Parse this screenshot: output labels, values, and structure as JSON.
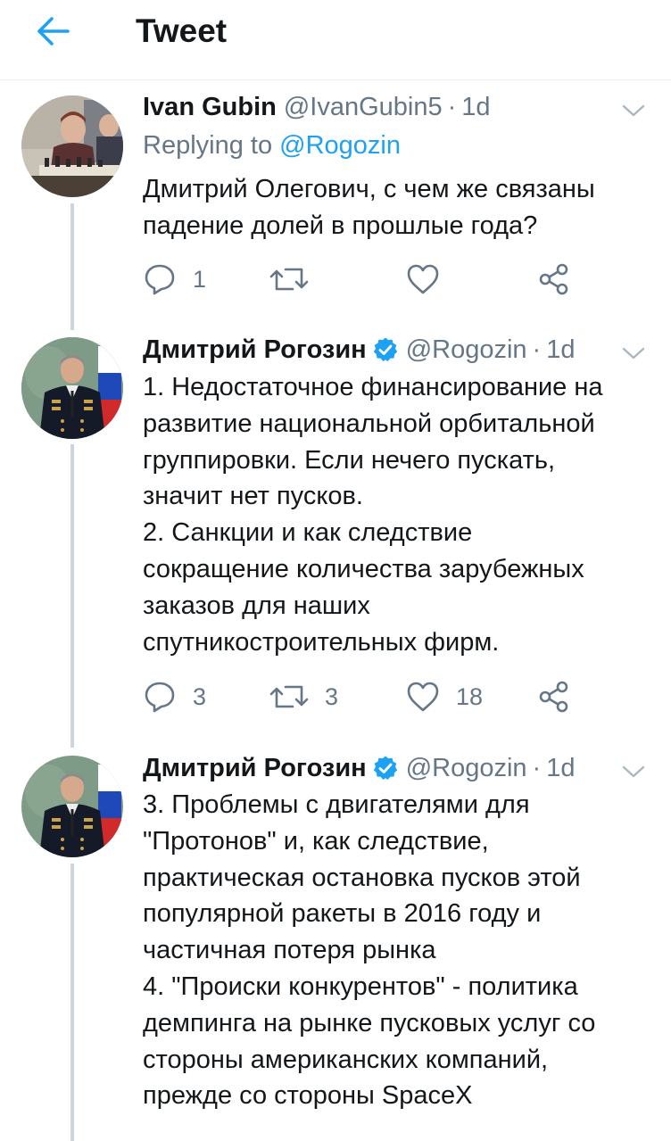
{
  "header": {
    "title": "Tweet",
    "back_icon": "arrow-left-icon",
    "accent": "#1da1f2"
  },
  "tweets": [
    {
      "name": "Ivan Gubin",
      "handle": "@IvanGubin5",
      "separator": "·",
      "time": "1d",
      "verified": false,
      "replying_prefix": "Replying to",
      "replying_mention": "@Rogozin",
      "text": "Дмитрий Олегович, с чем же связаны\nпадение долей в прошлые года?",
      "replies": "1",
      "retweets": "",
      "likes": ""
    },
    {
      "name": "Дмитрий Рогозин",
      "handle": "@Rogozin",
      "separator": "·",
      "time": "1d",
      "verified": true,
      "text": "1. Недостаточное финансирование на\nразвитие национальной орбитальной\nгруппировки. Если нечего пускать,\nзначит нет пусков.\n2. Санкции и как следствие\nсокращение количества зарубежных\nзаказов для наших\nспутникостроительных фирм.",
      "replies": "3",
      "retweets": "3",
      "likes": "18"
    },
    {
      "name": "Дмитрий Рогозин",
      "handle": "@Rogozin",
      "separator": "·",
      "time": "1d",
      "verified": true,
      "text": "3. Проблемы с двигателями для\n\"Протонов\" и, как следствие,\nпрактическая остановка пусков этой\nпопулярной ракеты в 2016 году и\nчастичная потеря рынка\n4. \"Происки конкурентов\" - политика\nдемпинга на рынке пусковых услуг со\nстороны американских компаний,\nпрежде со стороны SpaceX"
    }
  ],
  "colors": {
    "text": "#14171a",
    "secondary": "#657786",
    "verified": "#1da1f2",
    "divider": "#e6ecf0",
    "thread": "#ccd6dd"
  }
}
